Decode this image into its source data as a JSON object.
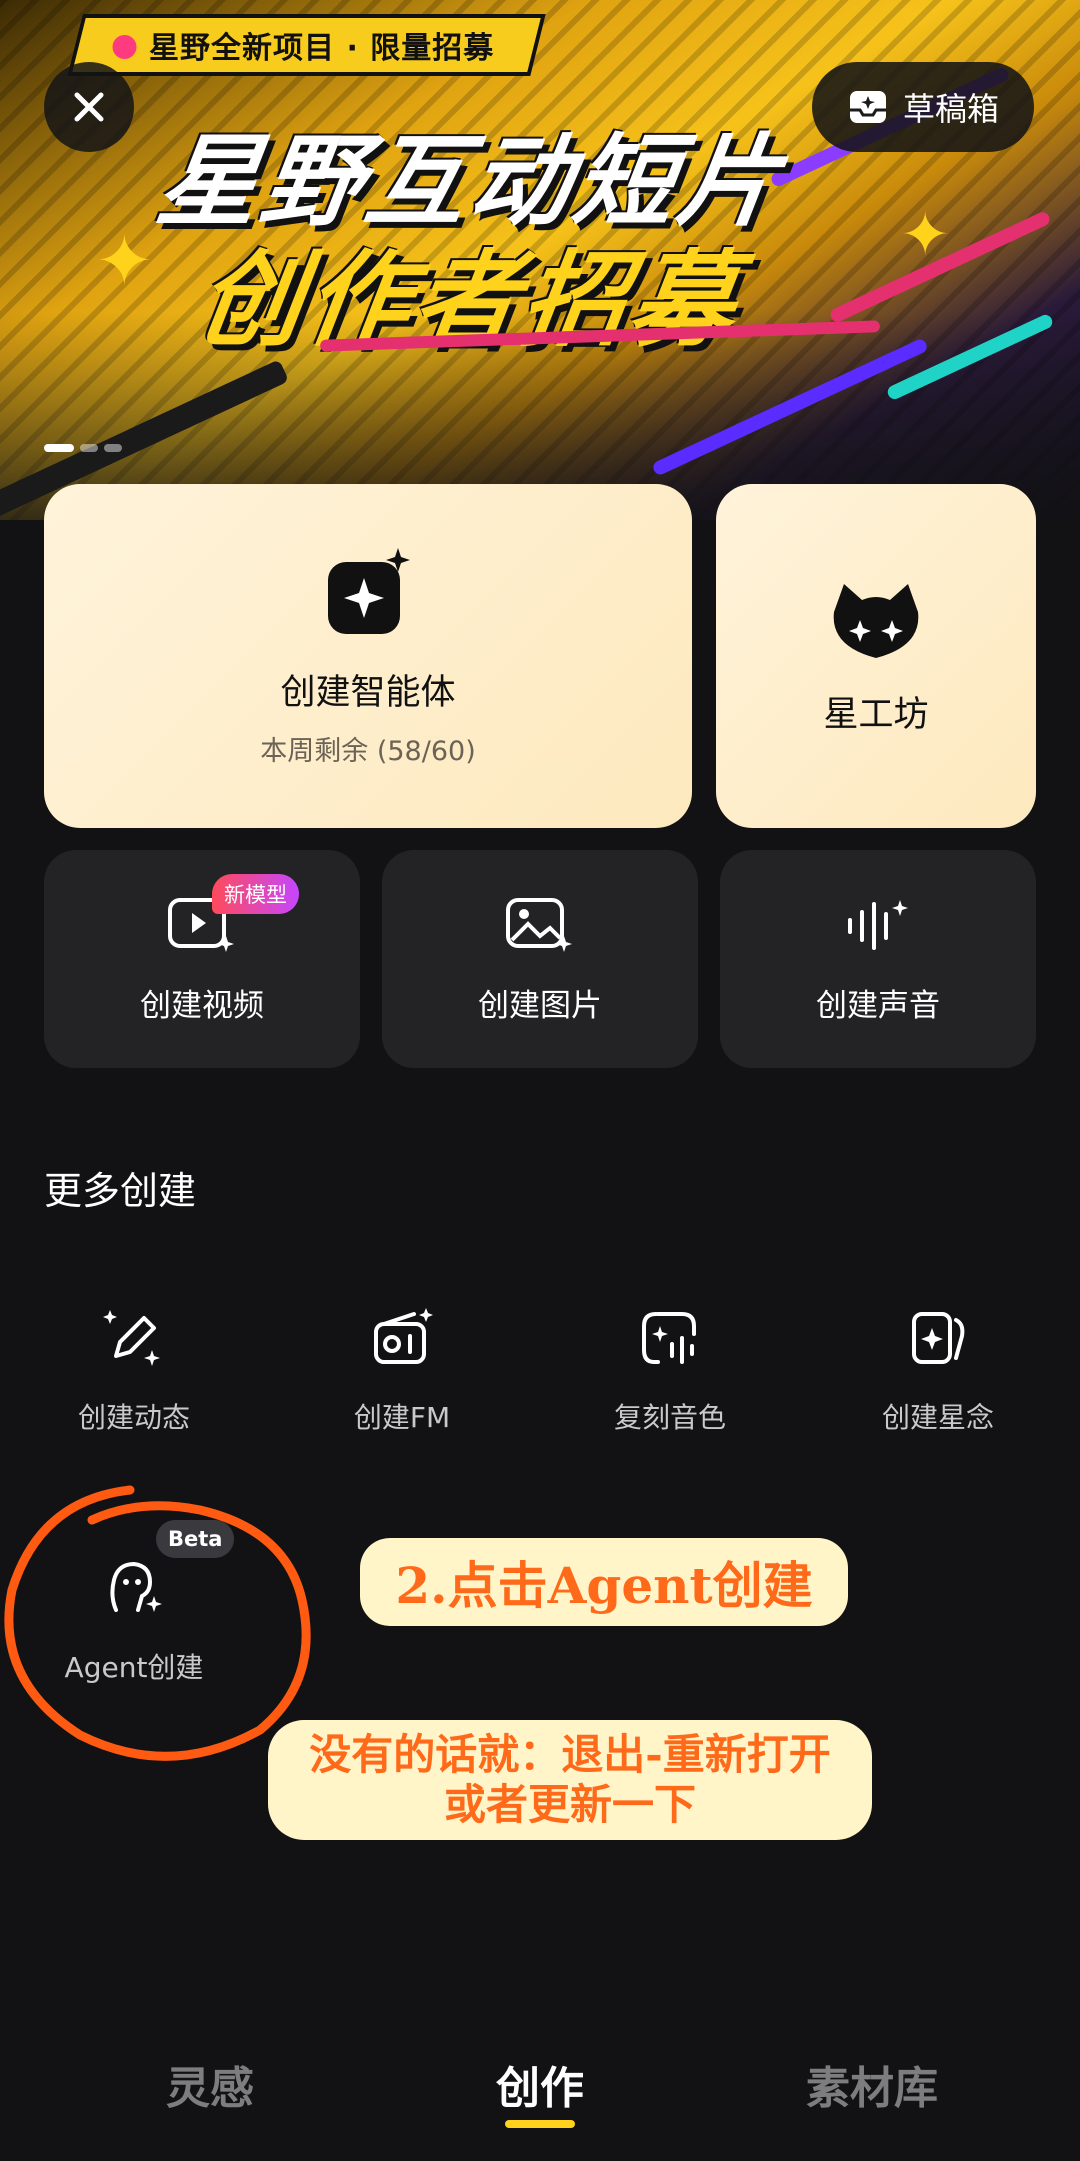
{
  "banner": {
    "tagline": "星野全新项目 · 限量招募",
    "title_line1": "星野互动短片",
    "title_line2": "创作者招募"
  },
  "header": {
    "draft_label": "草稿箱"
  },
  "primary_cards": [
    {
      "title": "创建智能体",
      "subtitle": "本周剩余 (58/60)",
      "icon": "sparkle-square-icon"
    },
    {
      "title": "星工坊",
      "icon": "cat-mascot-icon"
    }
  ],
  "secondary_cards": [
    {
      "title": "创建视频",
      "badge": "新模型",
      "icon": "video-play-icon"
    },
    {
      "title": "创建图片",
      "icon": "image-icon"
    },
    {
      "title": "创建声音",
      "icon": "soundwave-icon"
    }
  ],
  "more": {
    "title": "更多创建",
    "items": [
      {
        "label": "创建动态",
        "icon": "pencil-sparkle-icon"
      },
      {
        "label": "创建FM",
        "icon": "radio-icon"
      },
      {
        "label": "复刻音色",
        "icon": "voice-clone-icon"
      },
      {
        "label": "创建星念",
        "icon": "cards-icon"
      },
      {
        "label": "Agent创建",
        "icon": "agent-icon",
        "badge": "Beta"
      }
    ]
  },
  "annotations": {
    "step": "2.点击Agent创建",
    "note_line1": "没有的话就：退出-重新打开",
    "note_line2": "或者更新一下"
  },
  "tabs": [
    {
      "label": "灵感",
      "active": false
    },
    {
      "label": "创作",
      "active": true
    },
    {
      "label": "素材库",
      "active": false
    }
  ],
  "colors": {
    "background": "#121214",
    "card_dark": "#232326",
    "card_light": "#fff3da",
    "accent_yellow": "#ffd21c",
    "annotation_orange": "#ff6a1a"
  }
}
